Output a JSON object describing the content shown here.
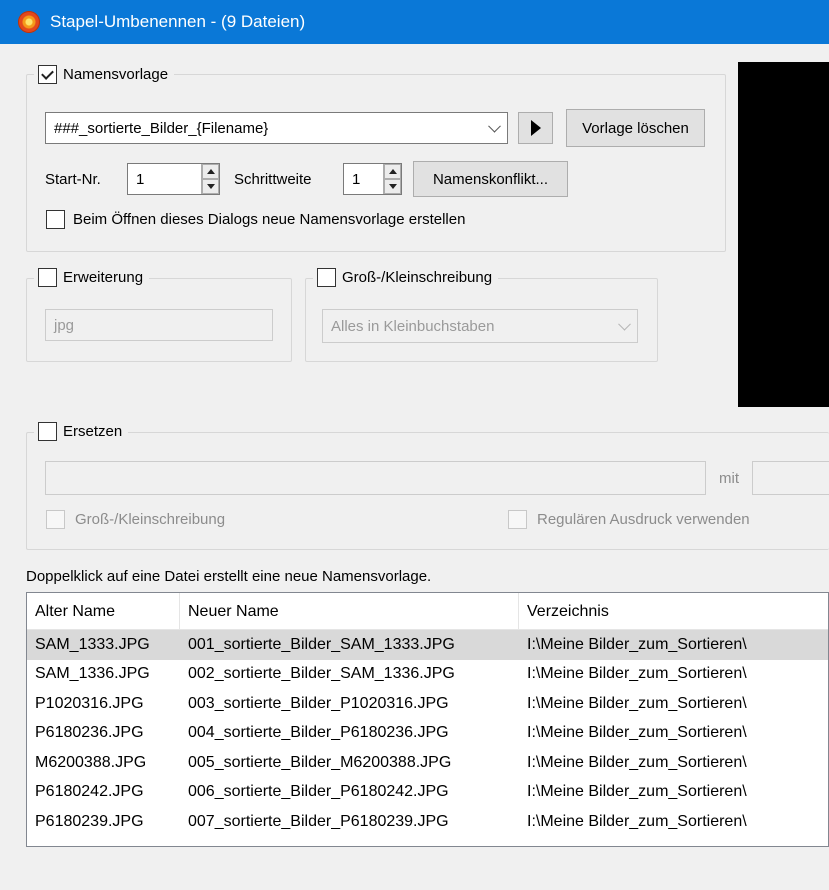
{
  "window": {
    "title": "Stapel-Umbenennen - (9 Dateien)",
    "icon": "app-flower-icon",
    "accent": "#0a78d7"
  },
  "name_template": {
    "checkbox_label": "Namensvorlage",
    "checked": true,
    "template_value": "###_sortierte_Bilder_{Filename}",
    "insert_button_icon": "play-triangle-icon",
    "delete_button_label": "Vorlage löschen",
    "start_label": "Start-Nr.",
    "start_value": "1",
    "step_label": "Schrittweite",
    "step_value": "1",
    "conflict_button_label": "Namenskonflikt...",
    "new_on_open_label": "Beim Öffnen dieses Dialogs neue Namensvorlage erstellen",
    "new_on_open_checked": false
  },
  "extension": {
    "checkbox_label": "Erweiterung",
    "checked": false,
    "value": "jpg"
  },
  "case": {
    "checkbox_label": "Groß-/Kleinschreibung",
    "checked": false,
    "selected": "Alles in Kleinbuchstaben"
  },
  "replace": {
    "checkbox_label": "Ersetzen",
    "checked": false,
    "search_value": "",
    "with_label": "mit",
    "replace_value": "",
    "case_label": "Groß-/Kleinschreibung",
    "regex_label": "Regulären Ausdruck verwenden"
  },
  "hint": "Doppelklick auf eine Datei erstellt eine neue Namensvorlage.",
  "file_list": {
    "columns": [
      "Alter Name",
      "Neuer Name",
      "Verzeichnis"
    ],
    "rows": [
      [
        "SAM_1333.JPG",
        "001_sortierte_Bilder_SAM_1333.JPG",
        "I:\\Meine Bilder_zum_Sortieren\\"
      ],
      [
        "SAM_1336.JPG",
        "002_sortierte_Bilder_SAM_1336.JPG",
        "I:\\Meine Bilder_zum_Sortieren\\"
      ],
      [
        "P1020316.JPG",
        "003_sortierte_Bilder_P1020316.JPG",
        "I:\\Meine Bilder_zum_Sortieren\\"
      ],
      [
        "P6180236.JPG",
        "004_sortierte_Bilder_P6180236.JPG",
        "I:\\Meine Bilder_zum_Sortieren\\"
      ],
      [
        "M6200388.JPG",
        "005_sortierte_Bilder_M6200388.JPG",
        "I:\\Meine Bilder_zum_Sortieren\\"
      ],
      [
        "P6180242.JPG",
        "006_sortierte_Bilder_P6180242.JPG",
        "I:\\Meine Bilder_zum_Sortieren\\"
      ],
      [
        "P6180239.JPG",
        "007_sortierte_Bilder_P6180239.JPG",
        "I:\\Meine Bilder_zum_Sortieren\\"
      ]
    ],
    "selected_row": 0
  }
}
